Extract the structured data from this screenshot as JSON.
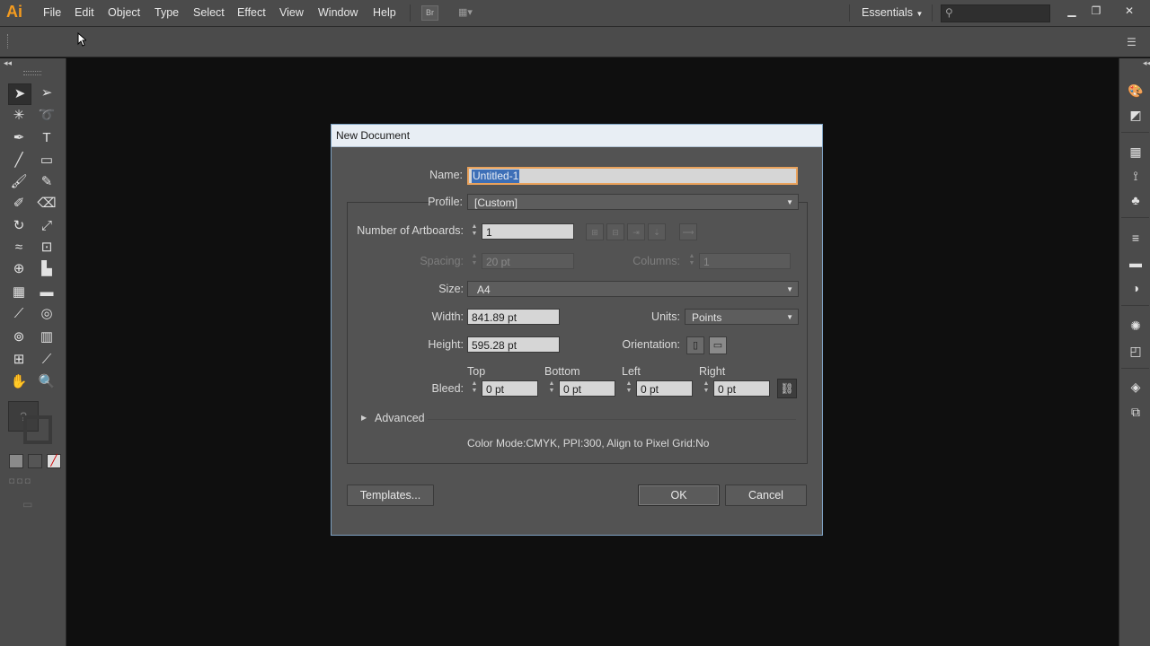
{
  "app": {
    "logo": "Ai"
  },
  "menu": [
    "File",
    "Edit",
    "Object",
    "Type",
    "Select",
    "Effect",
    "View",
    "Window",
    "Help"
  ],
  "bridge_button": "Br",
  "workspace": "Essentials",
  "search": {
    "placeholder": ""
  },
  "dialog": {
    "title": "New Document",
    "name_label": "Name:",
    "name_value": "Untitled-1",
    "profile_label": "Profile:",
    "profile_value": "[Custom]",
    "artboards_label": "Number of Artboards:",
    "artboards_value": "1",
    "spacing_label": "Spacing:",
    "spacing_value": "20 pt",
    "columns_label": "Columns:",
    "columns_value": "1",
    "size_label": "Size:",
    "size_value": "A4",
    "width_label": "Width:",
    "width_value": "841.89 pt",
    "units_label": "Units:",
    "units_value": "Points",
    "height_label": "Height:",
    "height_value": "595.28 pt",
    "orientation_label": "Orientation:",
    "bleed_label": "Bleed:",
    "bleed_headers": {
      "top": "Top",
      "bottom": "Bottom",
      "left": "Left",
      "right": "Right"
    },
    "bleed_values": {
      "top": "0 pt",
      "bottom": "0 pt",
      "left": "0 pt",
      "right": "0 pt"
    },
    "advanced_label": "Advanced",
    "info": "Color Mode:CMYK, PPI:300, Align to Pixel Grid:No",
    "templates_button": "Templates...",
    "ok_button": "OK",
    "cancel_button": "Cancel"
  },
  "colors": {
    "accent": "#f49b1f",
    "selection": "#3d6fb7",
    "focus_border": "#e9a25c",
    "bg_dark": "#0f0f0f",
    "panel": "#4b4b4b",
    "dialog": "#535353"
  }
}
